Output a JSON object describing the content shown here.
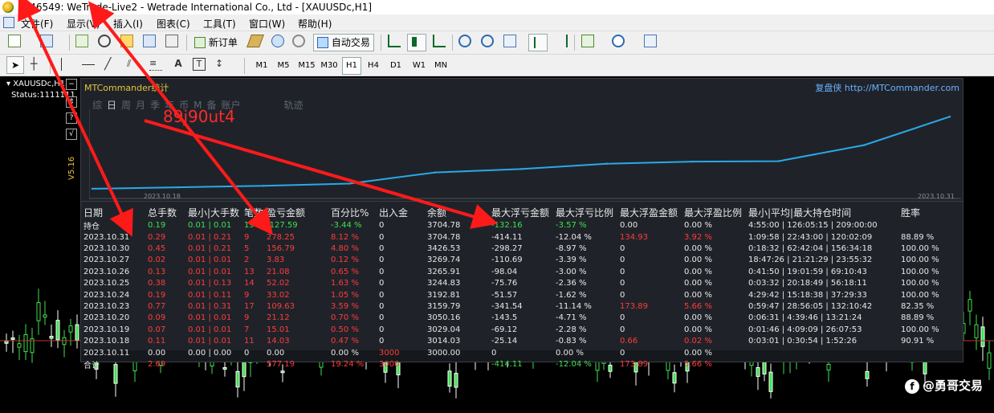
{
  "window": {
    "title": "5146549: WeTrade-Live2 - Wetrade International Co., Ltd - [XAUUSDc,H1]"
  },
  "menu": [
    "文件(F)",
    "显示(V)",
    "插入(I)",
    "图表(C)",
    "工具(T)",
    "窗口(W)",
    "帮助(H)"
  ],
  "toolbar": {
    "new_order": "新订单",
    "auto_trading": "自动交易"
  },
  "timeframes": [
    "M1",
    "M5",
    "M15",
    "M30",
    "H1",
    "H4",
    "D1",
    "W1",
    "MN"
  ],
  "active_timeframe": "H1",
  "chart": {
    "symbol_label": "XAUUSDc,H1",
    "status_label": "Status:1111111"
  },
  "panel": {
    "title": "MTCommander统计",
    "link": "复盘侠 http://MTCommander.com",
    "tabs": [
      "综",
      "日",
      "周",
      "月",
      "季",
      "年",
      "币",
      "M",
      "备",
      "账户",
      "轨迹"
    ],
    "active_tab": "日",
    "side_buttons": [
      "?",
      "√"
    ],
    "version": "V5.16",
    "x_start": "2023.10.18",
    "x_end": "2023.10.31",
    "overlay_code": "89j90ut4"
  },
  "chart_data": {
    "type": "line",
    "x": [
      "2023.10.11",
      "2023.10.18",
      "2023.10.19",
      "2023.10.20",
      "2023.10.23",
      "2023.10.24",
      "2023.10.25",
      "2023.10.26",
      "2023.10.27",
      "2023.10.30",
      "2023.10.31"
    ],
    "y": [
      3000,
      3014.03,
      3029.04,
      3050.16,
      3159.79,
      3192.81,
      3244.83,
      3265.91,
      3269.74,
      3426.53,
      3704.78
    ],
    "line_color": "#29a9e8"
  },
  "table": {
    "headers": [
      "日期",
      "总手数",
      "最小|大手数",
      "笔数",
      "盈亏金额",
      "百分比%",
      "出入金",
      "余额",
      "最大浮亏金额",
      "最大浮亏比例",
      "最大浮盈金额",
      "最大浮盈比例",
      "最小|平均|最大持仓时间",
      "胜率"
    ],
    "holding": {
      "label": "持仓",
      "lots": "0.19",
      "minmax": "0.01 | 0.01",
      "count": "19",
      "pnl": "-127.59",
      "pct": "-3.44 %",
      "io": "0",
      "balance": "3704.78",
      "maxdd": "-132.16",
      "maxdd_pct": "-3.57 %",
      "maxfp": "0.00",
      "maxfp_pct": "0.00 %",
      "time": "4:55:00 | 126:05:15 | 209:00:00",
      "win": ""
    },
    "rows": [
      {
        "date": "2023.10.31",
        "lots": "0.29",
        "minmax": "0.01 | 0.21",
        "count": "9",
        "pnl": "278.25",
        "pct": "8.12 %",
        "io": "0",
        "balance": "3704.78",
        "maxdd": "-414.11",
        "maxdd_pct": "-12.04 %",
        "maxfp": "134.93",
        "maxfp_pct": "3.92 %",
        "time": "1:09:58 | 22:43:00 | 120:02:09",
        "win": "88.89 %"
      },
      {
        "date": "2023.10.30",
        "lots": "0.45",
        "minmax": "0.01 | 0.21",
        "count": "5",
        "pnl": "156.79",
        "pct": "4.80 %",
        "io": "0",
        "balance": "3426.53",
        "maxdd": "-298.27",
        "maxdd_pct": "-8.97 %",
        "maxfp": "0",
        "maxfp_pct": "0.00 %",
        "time": "0:18:32 | 62:42:04 | 156:34:18",
        "win": "100.00 %"
      },
      {
        "date": "2023.10.27",
        "lots": "0.02",
        "minmax": "0.01 | 0.01",
        "count": "2",
        "pnl": "3.83",
        "pct": "0.12 %",
        "io": "0",
        "balance": "3269.74",
        "maxdd": "-110.69",
        "maxdd_pct": "-3.39 %",
        "maxfp": "0",
        "maxfp_pct": "0.00 %",
        "time": "18:47:26 | 21:21:29 | 23:55:32",
        "win": "100.00 %"
      },
      {
        "date": "2023.10.26",
        "lots": "0.13",
        "minmax": "0.01 | 0.01",
        "count": "13",
        "pnl": "21.08",
        "pct": "0.65 %",
        "io": "0",
        "balance": "3265.91",
        "maxdd": "-98.04",
        "maxdd_pct": "-3.00 %",
        "maxfp": "0",
        "maxfp_pct": "0.00 %",
        "time": "0:41:50 | 19:01:59 | 69:10:43",
        "win": "100.00 %"
      },
      {
        "date": "2023.10.25",
        "lots": "0.38",
        "minmax": "0.01 | 0.13",
        "count": "14",
        "pnl": "52.02",
        "pct": "1.63 %",
        "io": "0",
        "balance": "3244.83",
        "maxdd": "-75.76",
        "maxdd_pct": "-2.36 %",
        "maxfp": "0",
        "maxfp_pct": "0.00 %",
        "time": "0:03:32 | 20:18:49 | 56:18:11",
        "win": "100.00 %"
      },
      {
        "date": "2023.10.24",
        "lots": "0.19",
        "minmax": "0.01 | 0.11",
        "count": "9",
        "pnl": "33.02",
        "pct": "1.05 %",
        "io": "0",
        "balance": "3192.81",
        "maxdd": "-51.57",
        "maxdd_pct": "-1.62 %",
        "maxfp": "0",
        "maxfp_pct": "0.00 %",
        "time": "4:29:42 | 15:18:38 | 37:29:33",
        "win": "100.00 %"
      },
      {
        "date": "2023.10.23",
        "lots": "0.77",
        "minmax": "0.01 | 0.31",
        "count": "17",
        "pnl": "109.63",
        "pct": "3.59 %",
        "io": "0",
        "balance": "3159.79",
        "maxdd": "-341.54",
        "maxdd_pct": "-11.14 %",
        "maxfp": "173.89",
        "maxfp_pct": "5.66 %",
        "time": "0:59:47 | 28:56:05 | 132:10:42",
        "win": "82.35 %"
      },
      {
        "date": "2023.10.20",
        "lots": "0.09",
        "minmax": "0.01 | 0.01",
        "count": "9",
        "pnl": "21.12",
        "pct": "0.70 %",
        "io": "0",
        "balance": "3050.16",
        "maxdd": "-143.5",
        "maxdd_pct": "-4.71 %",
        "maxfp": "0",
        "maxfp_pct": "0.00 %",
        "time": "0:06:31 | 4:39:46 | 13:21:24",
        "win": "88.89 %"
      },
      {
        "date": "2023.10.19",
        "lots": "0.07",
        "minmax": "0.01 | 0.01",
        "count": "7",
        "pnl": "15.01",
        "pct": "0.50 %",
        "io": "0",
        "balance": "3029.04",
        "maxdd": "-69.12",
        "maxdd_pct": "-2.28 %",
        "maxfp": "0",
        "maxfp_pct": "0.00 %",
        "time": "0:01:46 | 4:09:09 | 26:07:53",
        "win": "100.00 %"
      },
      {
        "date": "2023.10.18",
        "lots": "0.11",
        "minmax": "0.01 | 0.01",
        "count": "11",
        "pnl": "14.03",
        "pct": "0.47 %",
        "io": "0",
        "balance": "3014.03",
        "maxdd": "-25.14",
        "maxdd_pct": "-0.83 %",
        "maxfp": "0.66",
        "maxfp_pct": "0.02 %",
        "time": "0:03:01 | 0:30:54 | 1:52:26",
        "win": "90.91 %"
      },
      {
        "date": "2023.10.11",
        "lots": "0.00",
        "minmax": "0.00 | 0.00",
        "count": "0",
        "pnl": "0.00",
        "pct": "0.00 %",
        "io": "3000",
        "balance": "3000.00",
        "maxdd": "0",
        "maxdd_pct": "0.00 %",
        "maxfp": "0",
        "maxfp_pct": "0.00 %",
        "time": "",
        "win": ""
      }
    ],
    "total": {
      "label": "合计",
      "lots": "2.69",
      "minmax": "",
      "count": "",
      "pnl": "577.19",
      "pct": "19.24 %",
      "io": "3000",
      "balance": "",
      "maxdd": "-414.11",
      "maxdd_pct": "-12.04 %",
      "maxfp": "173.89",
      "maxfp_pct": "5.66 %",
      "time": "",
      "win": ""
    }
  },
  "watermark": "@勇哥交易",
  "colors": {
    "red": "#ff3b3b",
    "green": "#3fe04f",
    "white": "#e8e8e8",
    "accent_line": "#29a9e8",
    "panel_bg": "#1f2329"
  }
}
